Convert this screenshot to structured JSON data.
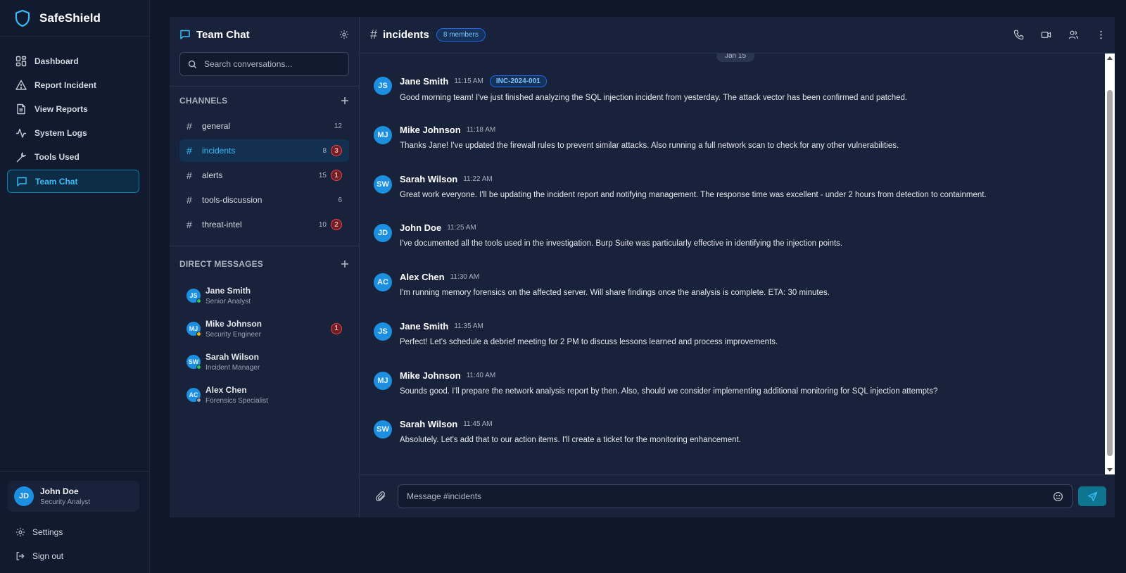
{
  "app": {
    "name": "SafeShield"
  },
  "nav": {
    "items": [
      {
        "label": "Dashboard",
        "icon": "dashboard-icon"
      },
      {
        "label": "Report Incident",
        "icon": "alert-triangle-icon"
      },
      {
        "label": "View Reports",
        "icon": "file-text-icon"
      },
      {
        "label": "System Logs",
        "icon": "activity-icon"
      },
      {
        "label": "Tools Used",
        "icon": "wrench-icon"
      },
      {
        "label": "Team Chat",
        "icon": "message-square-icon",
        "active": true
      }
    ]
  },
  "user": {
    "initials": "JD",
    "name": "John Doe",
    "role": "Security Analyst"
  },
  "bottom_links": {
    "settings": "Settings",
    "signout": "Sign out"
  },
  "chat_sidebar": {
    "title": "Team Chat",
    "search_placeholder": "Search conversations...",
    "channels_heading": "CHANNELS",
    "dm_heading": "DIRECT MESSAGES",
    "channels": [
      {
        "name": "general",
        "count": "12",
        "unread": ""
      },
      {
        "name": "incidents",
        "count": "8",
        "unread": "3",
        "active": true
      },
      {
        "name": "alerts",
        "count": "15",
        "unread": "1"
      },
      {
        "name": "tools-discussion",
        "count": "6",
        "unread": ""
      },
      {
        "name": "threat-intel",
        "count": "10",
        "unread": "2"
      }
    ],
    "direct_messages": [
      {
        "initials": "JS",
        "name": "Jane Smith",
        "role": "Senior Analyst",
        "status_color": "#22c55e",
        "unread": ""
      },
      {
        "initials": "MJ",
        "name": "Mike Johnson",
        "role": "Security Engineer",
        "status_color": "#eab308",
        "unread": "1"
      },
      {
        "initials": "SW",
        "name": "Sarah Wilson",
        "role": "Incident Manager",
        "status_color": "#22c55e",
        "unread": ""
      },
      {
        "initials": "AC",
        "name": "Alex Chen",
        "role": "Forensics Specialist",
        "status_color": "#9ca3af",
        "unread": ""
      }
    ]
  },
  "channel_header": {
    "name": "incidents",
    "members": "8 members"
  },
  "date_divider": "Jan 15",
  "messages": [
    {
      "initials": "JS",
      "author": "Jane Smith",
      "time": "11:15 AM",
      "tag": "INC-2024-001",
      "text": "Good morning team! I've just finished analyzing the SQL injection incident from yesterday. The attack vector has been confirmed and patched."
    },
    {
      "initials": "MJ",
      "author": "Mike Johnson",
      "time": "11:18 AM",
      "tag": "",
      "text": "Thanks Jane! I've updated the firewall rules to prevent similar attacks. Also running a full network scan to check for any other vulnerabilities."
    },
    {
      "initials": "SW",
      "author": "Sarah Wilson",
      "time": "11:22 AM",
      "tag": "",
      "text": "Great work everyone. I'll be updating the incident report and notifying management. The response time was excellent - under 2 hours from detection to containment."
    },
    {
      "initials": "JD",
      "author": "John Doe",
      "time": "11:25 AM",
      "tag": "",
      "text": "I've documented all the tools used in the investigation. Burp Suite was particularly effective in identifying the injection points."
    },
    {
      "initials": "AC",
      "author": "Alex Chen",
      "time": "11:30 AM",
      "tag": "",
      "text": "I'm running memory forensics on the affected server. Will share findings once the analysis is complete. ETA: 30 minutes."
    },
    {
      "initials": "JS",
      "author": "Jane Smith",
      "time": "11:35 AM",
      "tag": "",
      "text": "Perfect! Let's schedule a debrief meeting for 2 PM to discuss lessons learned and process improvements."
    },
    {
      "initials": "MJ",
      "author": "Mike Johnson",
      "time": "11:40 AM",
      "tag": "",
      "text": "Sounds good. I'll prepare the network analysis report by then. Also, should we consider implementing additional monitoring for SQL injection attempts?"
    },
    {
      "initials": "SW",
      "author": "Sarah Wilson",
      "time": "11:45 AM",
      "tag": "",
      "text": "Absolutely. Let's add that to our action items. I'll create a ticket for the monitoring enhancement."
    }
  ],
  "composer": {
    "placeholder": "Message #incidents"
  },
  "colors": {
    "accent": "#38bdf8",
    "background": "#0f1729",
    "panel": "#18223a",
    "avatar": "#1d8fe0",
    "badge_red": "#ef4444"
  }
}
